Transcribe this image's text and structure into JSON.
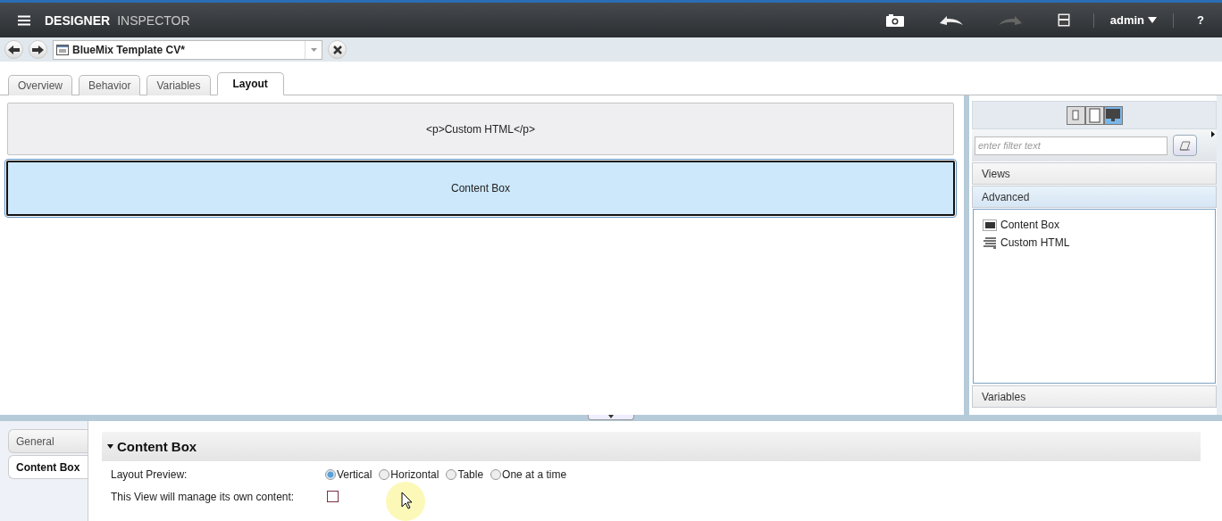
{
  "header": {
    "brand": "DESIGNER",
    "subtitle": "INSPECTOR",
    "user": "admin",
    "help": "?",
    "redo_enabled": false
  },
  "toolbar": {
    "document": "BlueMix Template CV*"
  },
  "tabs": [
    {
      "label": "Overview",
      "selected": false
    },
    {
      "label": "Behavior",
      "selected": false
    },
    {
      "label": "Variables",
      "selected": false
    },
    {
      "label": "Layout",
      "selected": true
    }
  ],
  "canvas": {
    "blocks": [
      {
        "label": "<p>Custom HTML</p>",
        "selected": false
      },
      {
        "label": "Content Box",
        "selected": true
      }
    ]
  },
  "palette": {
    "devices": [
      {
        "kind": "phone",
        "selected": false
      },
      {
        "kind": "tablet",
        "selected": false
      },
      {
        "kind": "desktop",
        "selected": true
      }
    ],
    "filter": {
      "placeholder": "enter filter text"
    },
    "sections": [
      {
        "label": "Views",
        "expanded": false
      },
      {
        "label": "Advanced",
        "expanded": true,
        "items": [
          {
            "kind": "box",
            "label": "Content Box"
          },
          {
            "kind": "html",
            "label": "Custom HTML"
          }
        ]
      },
      {
        "label": "Variables",
        "expanded": false
      }
    ]
  },
  "properties": {
    "side_tabs": [
      {
        "label": "General",
        "selected": false
      },
      {
        "label": "Content Box",
        "selected": true
      }
    ],
    "section": {
      "title": "Content Box",
      "expanded": true
    },
    "fields": [
      {
        "kind": "radio",
        "label": "Layout Preview:",
        "options": [
          {
            "label": "Vertical",
            "selected": true
          },
          {
            "label": "Horizontal",
            "selected": false
          },
          {
            "label": "Table",
            "selected": false
          },
          {
            "label": "One at a time",
            "selected": false
          }
        ]
      },
      {
        "kind": "checkbox",
        "label": "This View will manage its own content:",
        "checked": false
      }
    ]
  }
}
